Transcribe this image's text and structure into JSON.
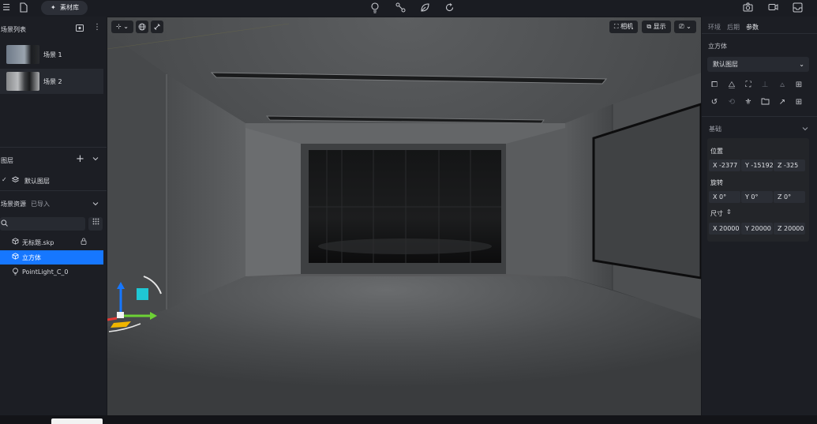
{
  "topbar": {
    "library_label": "素材库"
  },
  "left_panel": {
    "scene_list_title": "场景列表",
    "scenes": [
      {
        "name": "场景 1"
      },
      {
        "name": "场景 2"
      }
    ],
    "layers_title": "图层",
    "default_layer": "默认图层",
    "assets_tab": "场景资源",
    "imported_tab": "已导入",
    "search_placeholder": "",
    "resources": [
      {
        "name": "无标题.skp",
        "icon": "cube-icon"
      },
      {
        "name": "立方体",
        "icon": "cube-icon"
      },
      {
        "name": "PointLight_C_0",
        "icon": "light-bulb-icon"
      }
    ]
  },
  "viewport": {
    "camera_label": "相机",
    "display_label": "显示"
  },
  "right_panel": {
    "tabs": [
      "环境",
      "后期",
      "参数"
    ],
    "object_name": "立方体",
    "layer_select": "默认图层",
    "section_basic": "基础",
    "position_label": "位置",
    "rotation_label": "旋转",
    "size_label": "尺寸",
    "position": {
      "x": "X -2377",
      "y": "Y -15192",
      "z": "Z -325"
    },
    "rotation": {
      "x": "X 0°",
      "y": "Y 0°",
      "z": "Z 0°"
    },
    "size": {
      "x": "X 20000",
      "y": "Y 20000",
      "z": "Z 20000"
    }
  },
  "colors": {
    "accent": "#1677ff",
    "gizmo_cube": "#1fc7d4",
    "gizmo_x": "#6dd135",
    "gizmo_y": "#1677ff",
    "gizmo_z": "#e53935"
  }
}
